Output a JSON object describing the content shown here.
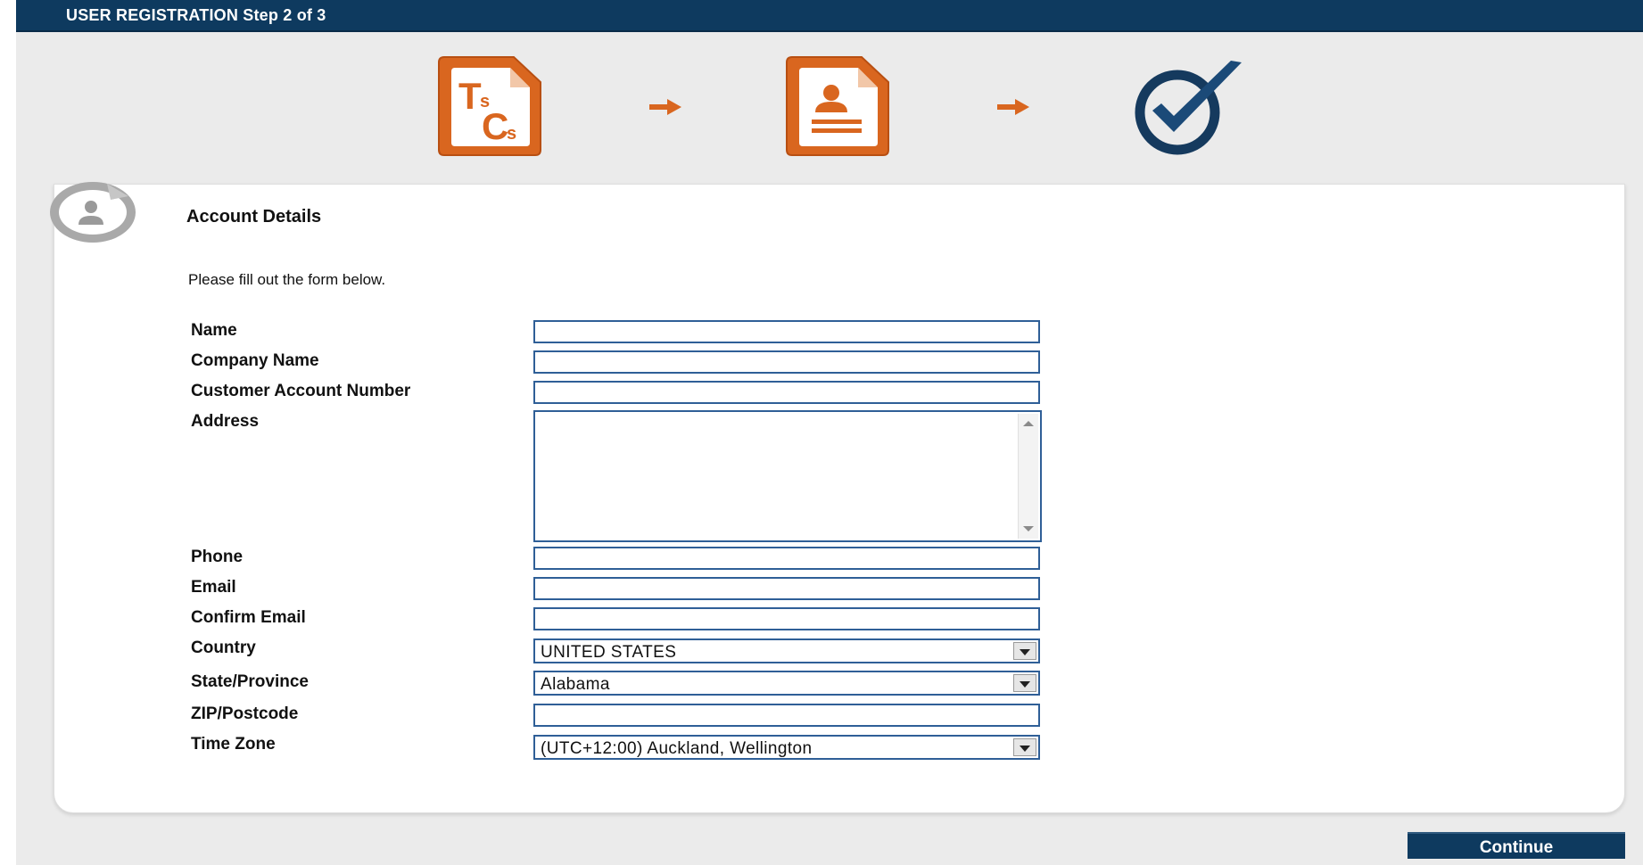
{
  "header": {
    "title": "USER REGISTRATION Step 2 of 3"
  },
  "steps": [
    {
      "icon": "terms-and-conditions-icon",
      "text": "TsCs",
      "color": "#d9661f"
    },
    {
      "icon": "user-form-icon",
      "color": "#d9661f"
    },
    {
      "icon": "checkmark-icon",
      "color": "#153a5e"
    }
  ],
  "section": {
    "title": "Account Details",
    "instructions": "Please fill out the form below."
  },
  "form": {
    "name": {
      "label": "Name",
      "value": ""
    },
    "company_name": {
      "label": "Company Name",
      "value": ""
    },
    "customer_account_number": {
      "label": "Customer Account Number",
      "value": ""
    },
    "address": {
      "label": "Address",
      "value": ""
    },
    "phone": {
      "label": "Phone",
      "value": ""
    },
    "email": {
      "label": "Email",
      "value": ""
    },
    "confirm_email": {
      "label": "Confirm Email",
      "value": ""
    },
    "country": {
      "label": "Country",
      "value": "UNITED STATES"
    },
    "state_province": {
      "label": "State/Province",
      "value": "Alabama"
    },
    "zip_postcode": {
      "label": "ZIP/Postcode",
      "value": ""
    },
    "time_zone": {
      "label": "Time Zone",
      "value": "(UTC+12:00) Auckland, Wellington"
    }
  },
  "footer": {
    "continue_label": "Continue"
  },
  "colors": {
    "brand_navy": "#0e3a5f",
    "accent_orange": "#d9661f",
    "field_border": "#2f5f97"
  }
}
